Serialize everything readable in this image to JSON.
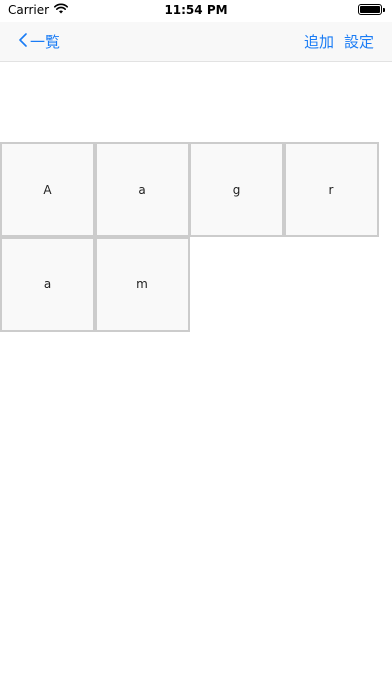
{
  "status_bar": {
    "carrier": "Carrier",
    "time": "11:54 PM",
    "battery_level": 1.0,
    "icons": [
      "wifi-icon",
      "battery-icon"
    ]
  },
  "nav": {
    "back_label": "一覧",
    "back_icon": "chevron-left-icon",
    "add_label": "追加",
    "settings_label": "設定",
    "accent_color": "#1a7cf5"
  },
  "grid": {
    "cells": [
      "A",
      "a",
      "g",
      "r",
      "a",
      "m"
    ]
  }
}
